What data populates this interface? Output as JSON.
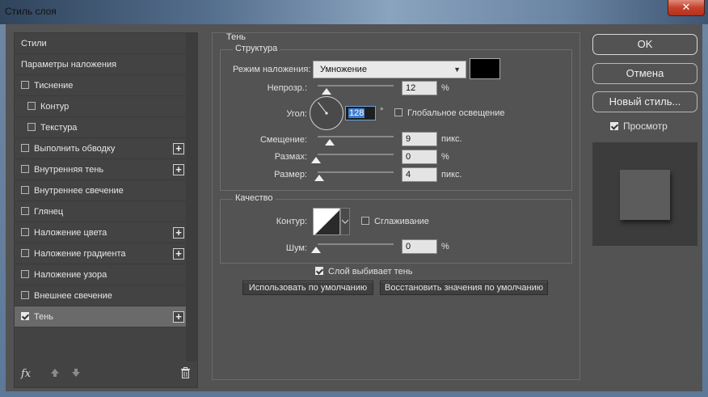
{
  "window": {
    "title": "Стиль слоя",
    "close_glyph": "✕"
  },
  "styles_list": [
    {
      "label": "Стили",
      "checkbox": false,
      "checked": false,
      "plus": false,
      "indent": false,
      "selected": false
    },
    {
      "label": "Параметры наложения",
      "checkbox": false,
      "checked": false,
      "plus": false,
      "indent": false,
      "selected": false
    },
    {
      "label": "Тиснение",
      "checkbox": true,
      "checked": false,
      "plus": false,
      "indent": false,
      "selected": false
    },
    {
      "label": "Контур",
      "checkbox": true,
      "checked": false,
      "plus": false,
      "indent": true,
      "selected": false
    },
    {
      "label": "Текстура",
      "checkbox": true,
      "checked": false,
      "plus": false,
      "indent": true,
      "selected": false
    },
    {
      "label": "Выполнить обводку",
      "checkbox": true,
      "checked": false,
      "plus": true,
      "indent": false,
      "selected": false
    },
    {
      "label": "Внутренняя тень",
      "checkbox": true,
      "checked": false,
      "plus": true,
      "indent": false,
      "selected": false
    },
    {
      "label": "Внутреннее свечение",
      "checkbox": true,
      "checked": false,
      "plus": false,
      "indent": false,
      "selected": false
    },
    {
      "label": "Глянец",
      "checkbox": true,
      "checked": false,
      "plus": false,
      "indent": false,
      "selected": false
    },
    {
      "label": "Наложение цвета",
      "checkbox": true,
      "checked": false,
      "plus": true,
      "indent": false,
      "selected": false
    },
    {
      "label": "Наложение градиента",
      "checkbox": true,
      "checked": false,
      "plus": true,
      "indent": false,
      "selected": false
    },
    {
      "label": "Наложение узора",
      "checkbox": true,
      "checked": false,
      "plus": false,
      "indent": false,
      "selected": false
    },
    {
      "label": "Внешнее свечение",
      "checkbox": true,
      "checked": false,
      "plus": false,
      "indent": false,
      "selected": false
    },
    {
      "label": "Тень",
      "checkbox": true,
      "checked": true,
      "plus": true,
      "indent": false,
      "selected": true
    }
  ],
  "left_footer": {
    "fx_label": "fx",
    "up_icon": "arrow-up-icon",
    "down_icon": "arrow-down-icon",
    "trash_icon": "trash-icon"
  },
  "shadow": {
    "section_title": "Тень",
    "structure": {
      "title": "Структура",
      "blend_mode_label": "Режим наложения:",
      "blend_mode_value": "Умножение",
      "shadow_color": "#000000",
      "opacity_label": "Непрозр.:",
      "opacity_value": "12",
      "opacity_unit": "%",
      "angle_label": "Угол:",
      "angle_value": "128",
      "angle_unit": "°",
      "global_light_label": "Глобальное освещение",
      "global_light_checked": false,
      "distance_label": "Смещение:",
      "distance_value": "9",
      "distance_unit": "пикс.",
      "spread_label": "Размах:",
      "spread_value": "0",
      "spread_unit": "%",
      "size_label": "Размер:",
      "size_value": "4",
      "size_unit": "пикс."
    },
    "quality": {
      "title": "Качество",
      "contour_label": "Контур:",
      "antialias_label": "Сглаживание",
      "antialias_checked": false,
      "noise_label": "Шум:",
      "noise_value": "0",
      "noise_unit": "%"
    },
    "knockout_label": "Слой выбивает тень",
    "knockout_checked": true,
    "make_default_label": "Использовать по умолчанию",
    "reset_default_label": "Восстановить значения по умолчанию"
  },
  "buttons": {
    "ok": "OK",
    "cancel": "Отмена",
    "new_style": "Новый стиль...",
    "preview_label": "Просмотр",
    "preview_checked": true
  }
}
